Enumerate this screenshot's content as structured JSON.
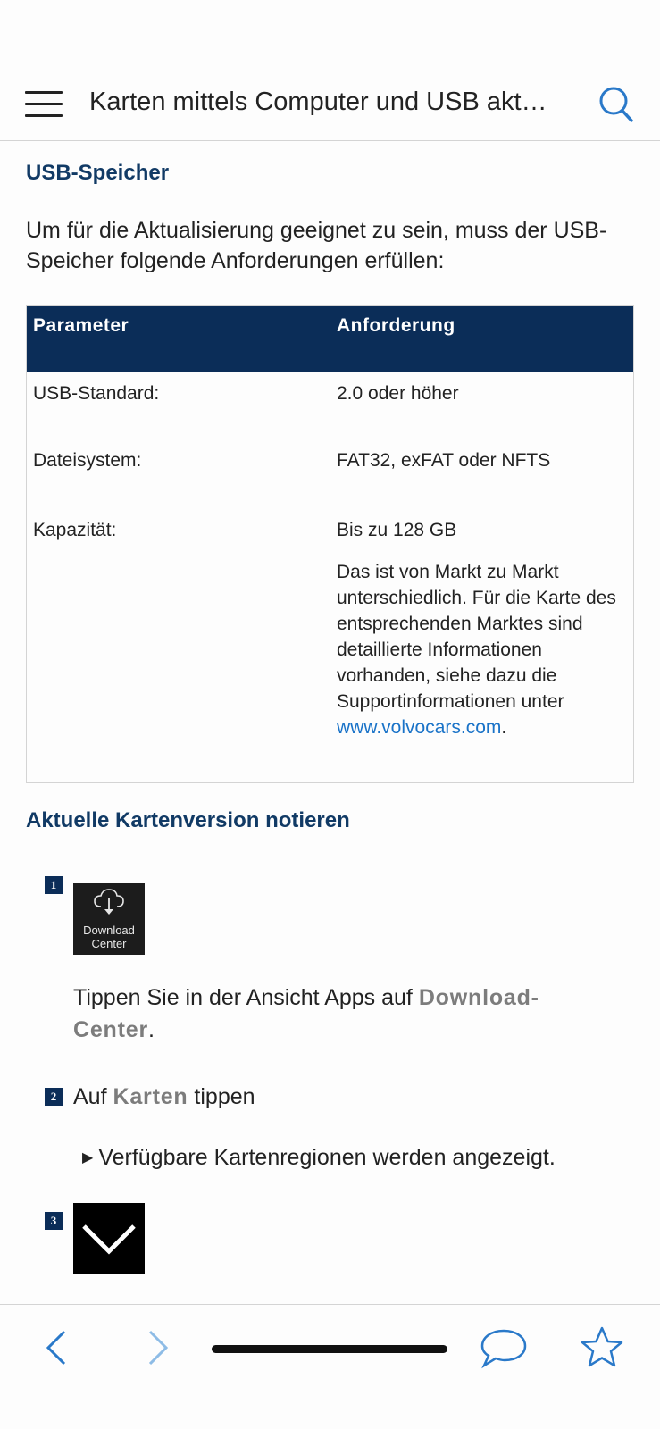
{
  "header": {
    "title": "Karten mittels Computer und USB akt…"
  },
  "usb_section": {
    "title": "USB-Speicher",
    "intro": "Um für die Aktualisierung geeignet zu sein, muss der USB-Speicher folgende Anforderungen erfüllen:",
    "table": {
      "headers": [
        "Parameter",
        "Anforderung"
      ],
      "rows": [
        {
          "param": "USB-Standard:",
          "value": "2.0 oder höher"
        },
        {
          "param": "Dateisystem:",
          "value": "FAT32, exFAT oder NFTS"
        },
        {
          "param": "Kapazität:",
          "value": "Bis zu 128 GB",
          "note": "Das ist von Markt zu Markt unterschiedlich. Für die Karte des entsprechenden Marktes sind detaillierte Informationen vorhanden, siehe dazu die Supportinformationen unter",
          "link": "www.volvocars.com",
          "note_end": "."
        }
      ]
    }
  },
  "map_section": {
    "title": "Aktuelle Kartenversion notieren",
    "steps": [
      {
        "number": "1",
        "tile_label_1": "Download",
        "tile_label_2": "Center",
        "text_before": "Tippen Sie in der Ansicht Apps auf ",
        "term": "Download-Center",
        "text_after": "."
      },
      {
        "number": "2",
        "text_before": "Auf ",
        "term": "Karten",
        "text_after": " tippen",
        "result": "Verfügbare Kartenregionen werden angezeigt."
      },
      {
        "number": "3"
      }
    ]
  },
  "icons": {
    "menu": "hamburger-menu-icon",
    "search": "search-icon",
    "back": "chevron-left-icon",
    "forward": "chevron-right-icon",
    "comment": "speech-bubble-icon",
    "favorite": "star-icon",
    "download": "cloud-download-icon",
    "expand": "chevron-down-icon"
  },
  "colors": {
    "accent": "#0b2d58",
    "title": "#113a65",
    "link": "#1a73c8",
    "nav_icon": "#2a79c9"
  }
}
